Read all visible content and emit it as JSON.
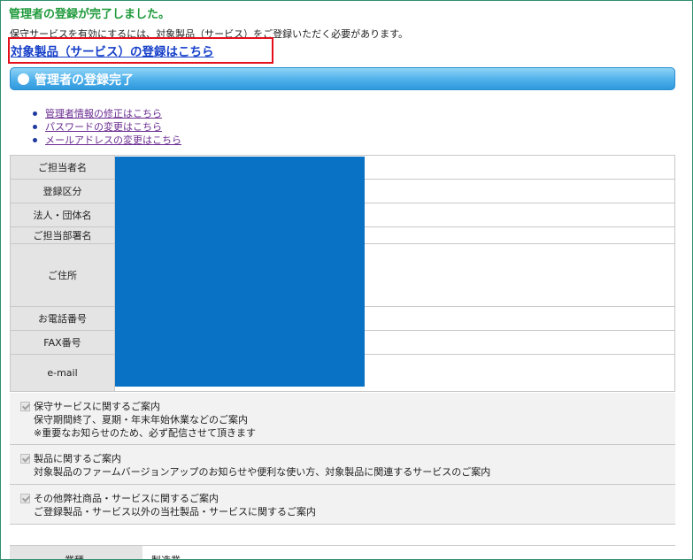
{
  "page": {
    "title": "管理者の登録が完了しました。",
    "notice": "保守サービスを有効にするには、対象製品（サービス）をご登録いただく必要があります。",
    "register_link": "対象製品（サービス）の登録はこちら"
  },
  "section": {
    "heading": "管理者の登録完了"
  },
  "links": [
    "管理者情報の修正はこちら",
    "パスワードの変更はこちら",
    "メールアドレスの変更はこちら"
  ],
  "info_table": {
    "rows": [
      "ご担当者名",
      "登録区分",
      "法人・団体名",
      "ご担当部署名",
      "ご住所",
      "お電話番号",
      "FAX番号",
      "e-mail"
    ]
  },
  "options": [
    {
      "label": "保守サービスに関するご案内",
      "lines": [
        "保守期間終了、夏期・年末年始休業などのご案内",
        "※重要なお知らせのため、必ず配信させて頂きます"
      ]
    },
    {
      "label": "製品に関するご案内",
      "lines": [
        "対象製品のファームバージョンアップのお知らせや便利な使い方、対象製品に関連するサービスのご案内"
      ]
    },
    {
      "label": "その他弊社商品・サービスに関するご案内",
      "lines": [
        "ご登録製品・サービス以外の当社製品・サービスに関するご案内"
      ]
    }
  ],
  "bottom": {
    "label": "業種",
    "value": "製造業"
  },
  "colors": {
    "title_green": "#1f9a3c",
    "link_blue": "#1740c9",
    "highlight_red": "#e3101c",
    "section_blue": "#4eb0ea",
    "redaction_blue": "#0a72c4"
  }
}
